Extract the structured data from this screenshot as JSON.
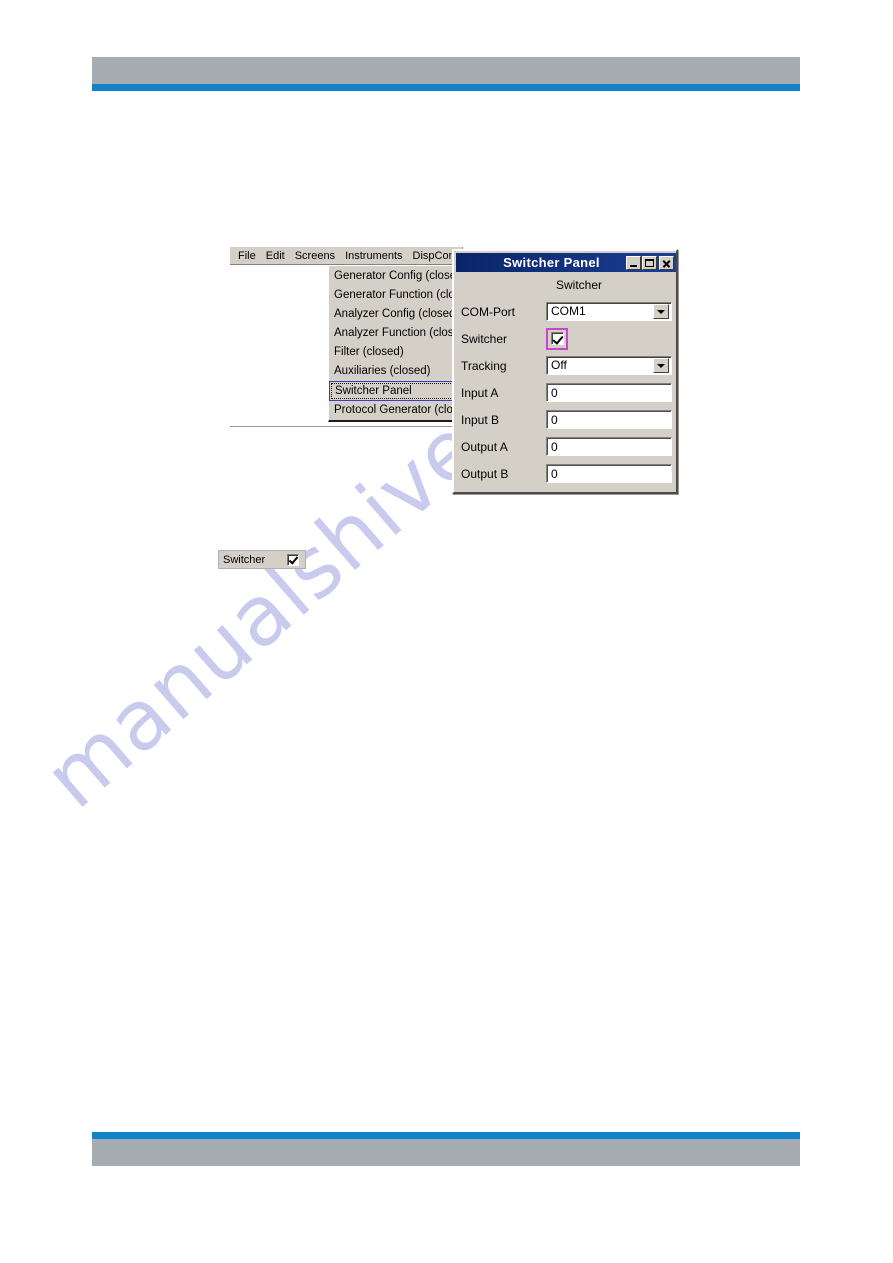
{
  "page": {
    "header_bar_color": "#a6adb2",
    "accent_rule_color": "#1283c8",
    "watermark_text": "manualshive.com"
  },
  "app_window": {
    "menubar": {
      "items": [
        {
          "label": "File"
        },
        {
          "label": "Edit"
        },
        {
          "label": "Screens"
        },
        {
          "label": "Instruments"
        },
        {
          "label": "DispConfig"
        }
      ]
    },
    "dropdown": {
      "open_from": "Instruments",
      "items": [
        {
          "label": "Generator Config (closed)",
          "selected": false
        },
        {
          "label": "Generator Function (closed)",
          "selected": false
        },
        {
          "label": "Analyzer Config (closed)",
          "selected": false
        },
        {
          "label": "Analyzer Function (closed)",
          "selected": false
        },
        {
          "label": "Filter (closed)",
          "selected": false
        },
        {
          "label": "Auxiliaries (closed)",
          "selected": false
        },
        {
          "label": "Switcher Panel",
          "selected": true
        },
        {
          "label": "Protocol Generator (closed)",
          "selected": false
        }
      ]
    }
  },
  "dialog": {
    "title": "Switcher Panel",
    "group_label": "Switcher",
    "highlight_color": "#cc44cc",
    "titlebar_color": "#0a246a",
    "buttons": {
      "minimize": "_",
      "maximize": "□",
      "close": "X"
    },
    "fields": {
      "com_port": {
        "label": "COM-Port",
        "value": "COM1"
      },
      "switcher": {
        "label": "Switcher",
        "checked": true
      },
      "tracking": {
        "label": "Tracking",
        "value": "Off"
      },
      "input_a": {
        "label": "Input A",
        "value": "0"
      },
      "input_b": {
        "label": "Input B",
        "value": "0"
      },
      "output_a": {
        "label": "Output A",
        "value": "0"
      },
      "output_b": {
        "label": "Output B",
        "value": "0"
      }
    }
  },
  "snippet": {
    "label": "Switcher",
    "checked": true
  }
}
